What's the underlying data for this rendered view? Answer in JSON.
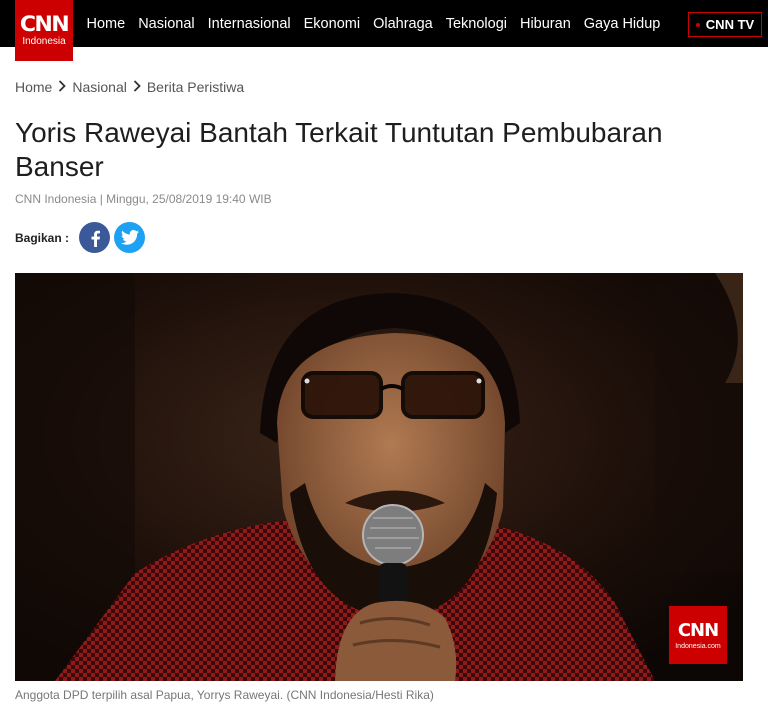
{
  "brand": {
    "logo_main": "CNN",
    "logo_sub": "Indonesia"
  },
  "nav": [
    "Home",
    "Nasional",
    "Internasional",
    "Ekonomi",
    "Olahraga",
    "Teknologi",
    "Hiburan",
    "Gaya Hidup"
  ],
  "cnntv_label": "CNN TV",
  "breadcrumb": [
    "Home",
    "Nasional",
    "Berita Peristiwa"
  ],
  "article": {
    "title": "Yoris Raweyai Bantah Terkait Tuntutan Pembubaran Banser",
    "meta": "CNN Indonesia | Minggu, 25/08/2019 19:40 WIB",
    "share_label": "Bagikan :",
    "share_buttons": [
      "facebook-icon",
      "twitter-icon"
    ],
    "photo_watermark_main": "CNN",
    "photo_watermark_sub": "Indonesia.com",
    "caption": "Anggota DPD terpilih asal Papua, Yorrys Raweyai. (CNN Indonesia/Hesti Rika)"
  },
  "colors": {
    "brand_red": "#cc0000",
    "topbar": "#000000",
    "facebook": "#3b5998",
    "twitter": "#1da1f2"
  }
}
